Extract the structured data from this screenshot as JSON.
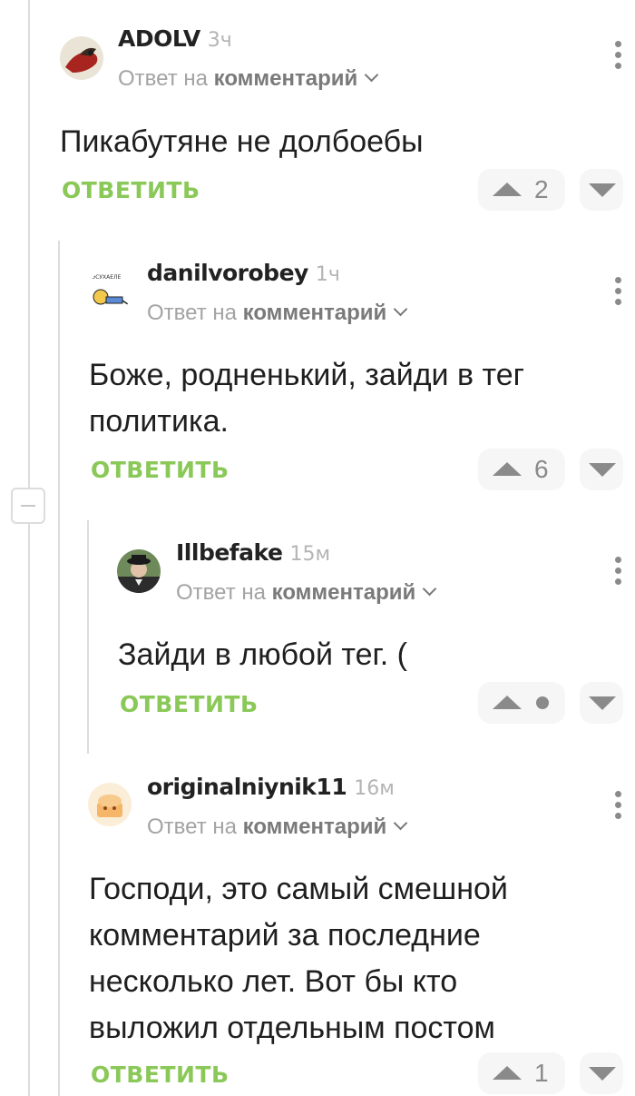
{
  "labels": {
    "reply_to": "Ответ на",
    "comment_word": "комментарий",
    "reply_action": "ОТВЕТИТЬ"
  },
  "comments": [
    {
      "author": "ADOLV",
      "time": "3ч",
      "text": [
        "Пикабутяне не долбоебы"
      ],
      "rating": "2"
    },
    {
      "author": "danilvorobey",
      "time": "1ч",
      "text": [
        "Боже, родненький, зайди в тег",
        "политика."
      ],
      "rating": "6"
    },
    {
      "author": "Illbefake",
      "time": "15м",
      "text": [
        "Зайди в любой тег. ("
      ],
      "rating": ""
    },
    {
      "author": "originalniynik11",
      "time": "16м",
      "text": [
        "Господи, это самый смешной",
        "комментарий за последние",
        "несколько лет. Вот бы кто",
        "выложил отдельным постом"
      ],
      "rating": "1"
    }
  ],
  "colors": {
    "accent_green": "#8ac858",
    "muted": "#a3a3a3"
  }
}
